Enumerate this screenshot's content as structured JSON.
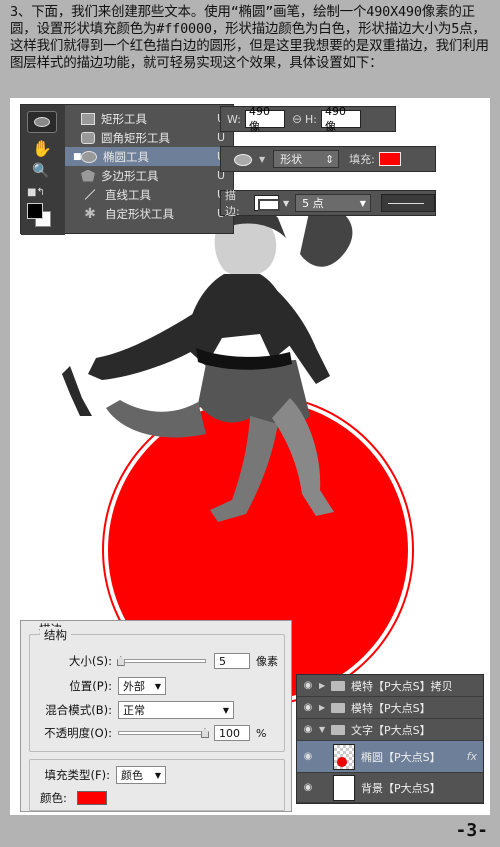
{
  "intro_text": "3、下面，我们来创建那些文本。使用“椭圆”画笔，绘制一个490X490像素的正圆，设置形状填充颜色为#ff0000，形状描边颜色为白色，形状描边大小为5点，这样我们就得到一个红色描白边的圆形，但是这里我想要的是双重描边，我们利用图层样式的描边功能，就可轻易实现这个效果，具体设置如下：",
  "tool_menu": [
    {
      "label": "矩形工具",
      "key": "U",
      "icon": "rectangle-icon"
    },
    {
      "label": "圆角矩形工具",
      "key": "U",
      "icon": "rounded-rectangle-icon"
    },
    {
      "label": "椭圆工具",
      "key": "U",
      "icon": "ellipse-icon",
      "active": true
    },
    {
      "label": "多边形工具",
      "key": "U",
      "icon": "polygon-icon"
    },
    {
      "label": "直线工具",
      "key": "U",
      "icon": "line-icon"
    },
    {
      "label": "自定形状工具",
      "key": "U",
      "icon": "custom-shape-icon"
    }
  ],
  "options": {
    "w_label": "W:",
    "w_value": "490 像",
    "h_label": "H:",
    "h_value": "490 像",
    "mode_value": "形状",
    "fill_label": "填充:",
    "fill_color": "#ff0000",
    "stroke_label": "描边:",
    "stroke_size": "5 点"
  },
  "stroke_dialog": {
    "title": "描边",
    "structure_label": "结构",
    "size_label": "大小(S):",
    "size_value": "5",
    "size_unit": "像素",
    "size_fraction": 0.02,
    "position_label": "位置(P):",
    "position_value": "外部",
    "blend_label": "混合模式(B):",
    "blend_value": "正常",
    "opacity_label": "不透明度(O):",
    "opacity_value": "100",
    "opacity_unit": "%",
    "opacity_fraction": 1.0,
    "fill_type_label": "填充类型(F):",
    "fill_type_value": "颜色",
    "color_label": "颜色:",
    "color": "#ff0000"
  },
  "layers": [
    {
      "name": "模特【P大点S】拷贝",
      "type": "folder",
      "expanded": false
    },
    {
      "name": "模特【P大点S】",
      "type": "folder",
      "expanded": false
    },
    {
      "name": "文字【P大点S】",
      "type": "folder",
      "expanded": true
    },
    {
      "name": "椭圆【P大点S】",
      "type": "shape",
      "selected": true,
      "fx": "fx"
    },
    {
      "name": "背景【P大点S】",
      "type": "background"
    }
  ],
  "page_number": "-3-"
}
